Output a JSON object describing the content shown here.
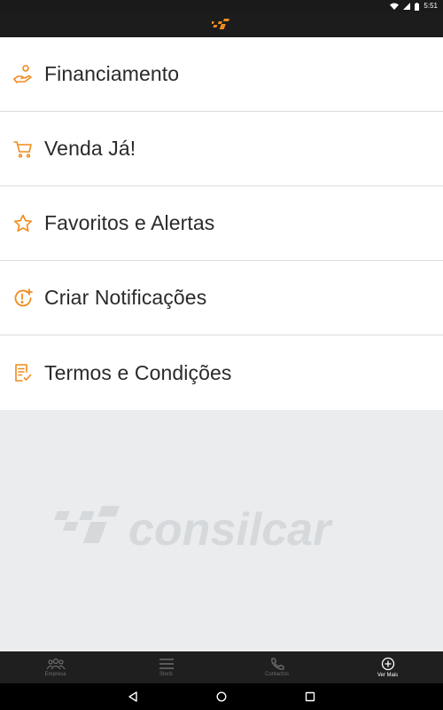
{
  "status_bar": {
    "time": "5:51"
  },
  "menu": {
    "items": [
      {
        "label": "Financiamento"
      },
      {
        "label": "Venda Já!"
      },
      {
        "label": "Favoritos e Alertas"
      },
      {
        "label": "Criar Notificações"
      },
      {
        "label": "Termos e Condições"
      }
    ]
  },
  "watermark": {
    "text": "consilcar"
  },
  "bottom_nav": {
    "items": [
      {
        "label": "Empresa"
      },
      {
        "label": "Stock"
      },
      {
        "label": "Contactos"
      },
      {
        "label": "Ver Mais"
      }
    ]
  },
  "colors": {
    "accent": "#f08a1c",
    "inactive": "#6d6d6d",
    "active": "#ffffff"
  }
}
